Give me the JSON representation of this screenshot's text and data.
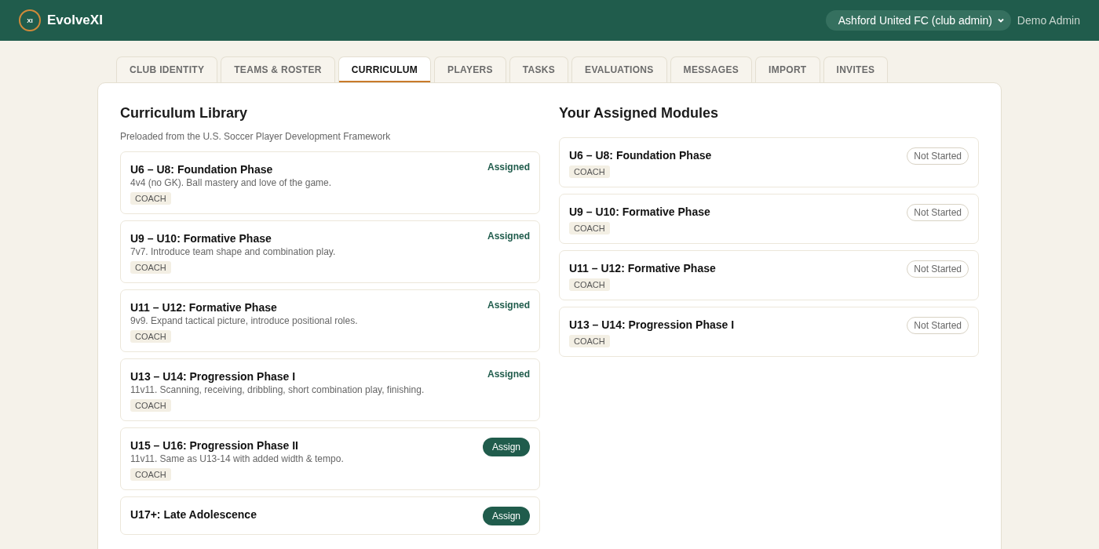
{
  "header": {
    "logo_mark": "XI",
    "brand": "EvolveXI",
    "club_select": "Ashford United FC (club admin)",
    "user": "Demo Admin"
  },
  "tabs": [
    {
      "label": "CLUB IDENTITY",
      "selected": false
    },
    {
      "label": "TEAMS & ROSTER",
      "selected": false
    },
    {
      "label": "CURRICULUM",
      "selected": true
    },
    {
      "label": "PLAYERS",
      "selected": false
    },
    {
      "label": "TASKS",
      "selected": false
    },
    {
      "label": "EVALUATIONS",
      "selected": false
    },
    {
      "label": "MESSAGES",
      "selected": false
    },
    {
      "label": "IMPORT",
      "selected": false
    },
    {
      "label": "INVITES",
      "selected": false
    }
  ],
  "library": {
    "title": "Curriculum Library",
    "subtitle": "Preloaded from the U.S. Soccer Player Development Framework",
    "modules": [
      {
        "title": "U6 – U8: Foundation Phase",
        "description": "4v4 (no GK). Ball mastery and love of the game.",
        "tag": "COACH",
        "assigned": true,
        "status": "Assigned"
      },
      {
        "title": "U9 – U10: Formative Phase",
        "description": "7v7. Introduce team shape and combination play.",
        "tag": "COACH",
        "assigned": true,
        "status": "Assigned"
      },
      {
        "title": "U11 – U12: Formative Phase",
        "description": "9v9. Expand tactical picture, introduce positional roles.",
        "tag": "COACH",
        "assigned": true,
        "status": "Assigned"
      },
      {
        "title": "U13 – U14: Progression Phase I",
        "description": "11v11. Scanning, receiving, dribbling, short combination play, finishing.",
        "tag": "COACH",
        "assigned": true,
        "status": "Assigned"
      },
      {
        "title": "U15 – U16: Progression Phase II",
        "description": "11v11. Same as U13-14 with added width & tempo.",
        "tag": "COACH",
        "assigned": false,
        "status": "Assign"
      },
      {
        "title": "U17+: Late Adolescence",
        "assigned": false,
        "status": "Assign"
      }
    ]
  },
  "assigned": {
    "title": "Your Assigned Modules",
    "modules": [
      {
        "title": "U6 – U8: Foundation Phase",
        "tag": "COACH",
        "status": "Not Started"
      },
      {
        "title": "U9 – U10: Formative Phase",
        "tag": "COACH",
        "status": "Not Started"
      },
      {
        "title": "U11 – U12: Formative Phase",
        "tag": "COACH",
        "status": "Not Started"
      },
      {
        "title": "U13 – U14: Progression Phase I",
        "tag": "COACH",
        "status": "Not Started"
      }
    ]
  }
}
